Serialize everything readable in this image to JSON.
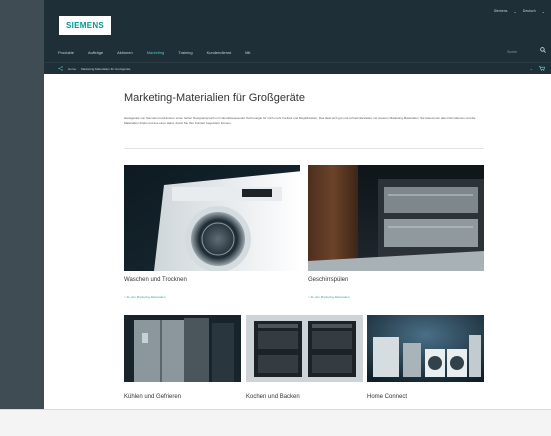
{
  "brand": {
    "logo_text": "SIEMENS"
  },
  "top_links": [
    "Siemens",
    "Deutsch"
  ],
  "nav": {
    "items": [
      "Produkte",
      "Aufträge",
      "Aktionen",
      "Marketing",
      "Training",
      "Kundendienst",
      "Mit"
    ],
    "active_index": 3,
    "search_placeholder": "Suche"
  },
  "breadcrumb": [
    "Home",
    "Marketing-Materialien für Großgeräte"
  ],
  "page": {
    "title": "Marketing-Materialien für Großgeräte",
    "intro": "Hausgeräte von Siemens kombinieren einen hohen Designanspruch mit zukunftsweisender Technologie für noch mehr Freiheit und Möglichkeiten. Das lässt sich gut und schnell darstellen mit unseren Marketing-Materialien. Sie bekommen alle Informationen und die Materialien direkt und aus einer Hand, damit Sie Ihre Kunden begeistern können."
  },
  "tiles": [
    {
      "label": "Waschen und Trocknen",
      "link": "> Zu den Marketing-Materialien"
    },
    {
      "label": "Geschirrspülen",
      "link": "> Zu den Marketing-Materialien"
    },
    {
      "label": "Kühlen und Gefrieren"
    },
    {
      "label": "Kochen und Backen"
    },
    {
      "label": "Home Connect"
    }
  ],
  "colors": {
    "header_bg": "#1f2f37",
    "accent": "#52c4c8",
    "link": "#3aa8ae",
    "logo": "#009999"
  }
}
